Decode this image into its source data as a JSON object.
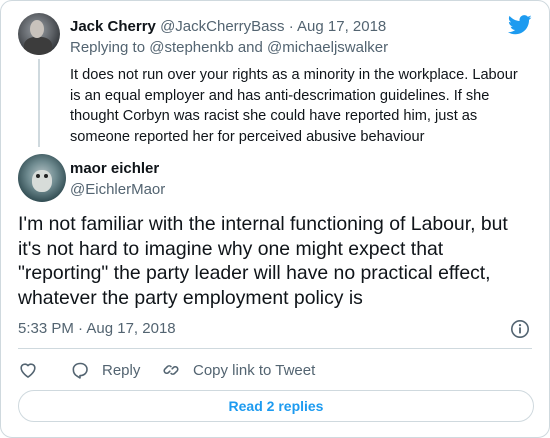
{
  "parent_tweet": {
    "author_name": "Jack Cherry",
    "author_handle": "@JackCherryBass",
    "separator": "·",
    "date": "Aug 17, 2018",
    "replying_prefix": "Replying to",
    "replying_to_1": "@stephenkb",
    "replying_and": "and",
    "replying_to_2": "@michaeljswalker",
    "text": "It does not run over your rights as a minority in the workplace. Labour is an equal employer and has anti-descrimation guidelines. If she thought Corbyn was racist she could have reported him, just as someone reported her for perceived abusive behaviour"
  },
  "main_tweet": {
    "author_name": "maor eichler",
    "author_handle": "@EichlerMaor",
    "text": "I'm not familiar with the internal functioning of Labour, but it's not hard to imagine why one might expect that \"reporting\" the party leader will have no practical effect, whatever the party employment policy is",
    "time": "5:33 PM",
    "separator": "·",
    "date": "Aug 17, 2018"
  },
  "actions": {
    "reply_label": "Reply",
    "copy_label": "Copy link to Tweet"
  },
  "read_replies_label": "Read 2 replies",
  "icons": {
    "brand": "twitter-bird-icon",
    "info": "info-icon",
    "like": "heart-icon",
    "reply": "speech-bubble-icon",
    "copy": "link-icon"
  },
  "colors": {
    "brand_blue": "#1d9bf0",
    "text_primary": "#0f1419",
    "text_muted": "#536471",
    "border": "#cfd9de"
  }
}
